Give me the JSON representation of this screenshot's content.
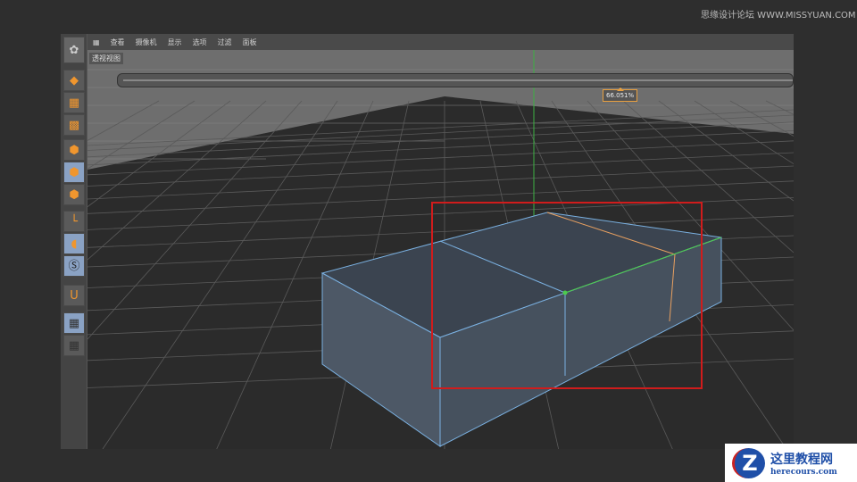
{
  "watermark_top": "思缘设计论坛 WWW.MISSYUAN.COM",
  "menu": [
    "查看",
    "摄像机",
    "显示",
    "选项",
    "过滤",
    "面板"
  ],
  "view_title": "透视视图",
  "slider": {
    "value_label": "66.051%",
    "value_percent": 66.051
  },
  "toolbar_icons": [
    "model-icon",
    "texture-icon",
    "uv-icon",
    "points-icon",
    "edges-icon",
    "polygons-icon",
    "axis-icon",
    "mouse-icon",
    "snap-icon",
    "magnet-icon",
    "workplane-lock-icon",
    "workplane-icon"
  ],
  "watermark_bottom": {
    "title": "这里教程网",
    "url": "herecours.com",
    "logo": "Z"
  },
  "colors": {
    "selection": "#d01c1c",
    "accent": "#f0962e",
    "edge_highlight": "#e8a060"
  }
}
